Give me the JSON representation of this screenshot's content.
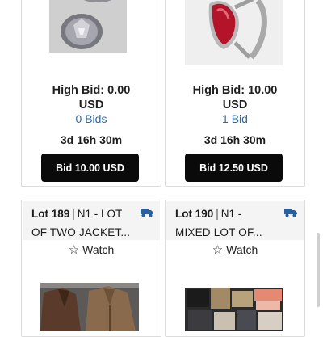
{
  "cards_top": [
    {
      "high_bid": "High Bid: 0.00",
      "currency": "USD",
      "bids": "0 Bids",
      "time_left": "3d 16h 30m",
      "button": "Bid 10.00 USD"
    },
    {
      "high_bid": "High Bid: 10.00",
      "currency": "USD",
      "bids": "1 Bid",
      "time_left": "3d 16h 30m",
      "button": "Bid 12.50 USD"
    }
  ],
  "cards_bottom": [
    {
      "lot": "Lot 189",
      "sep": "|",
      "title_line1": "N1 - LOT",
      "title_line2": "OF TWO JACKET...",
      "watch": "Watch",
      "shipping_icon": "truck-icon"
    },
    {
      "lot": "Lot 190",
      "sep": "|",
      "title_line1": "N1 -",
      "title_line2": "MIXED LOT OF...",
      "watch": "Watch",
      "shipping_icon": "truck-icon"
    }
  ],
  "colors": {
    "button_bg": "#0a0a0a",
    "bids_link": "#2a6aa8",
    "truck": "#2d5f9a"
  }
}
